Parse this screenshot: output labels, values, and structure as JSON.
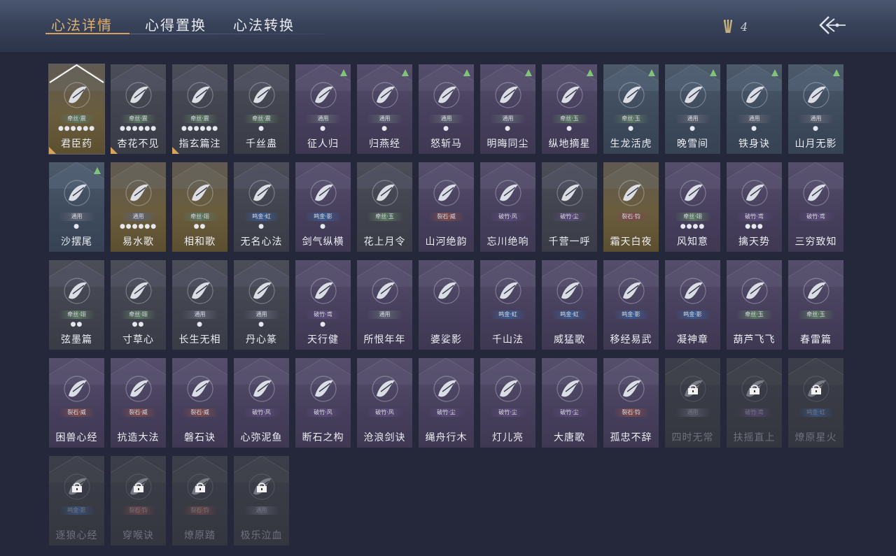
{
  "tabs": [
    "心法详情",
    "心得置换",
    "心法转换"
  ],
  "currency": {
    "icon": "arrow-bundle-icon",
    "value": "4"
  },
  "colors": {
    "accent": "#d6a062",
    "upgrade": "#7fc47a",
    "background": "#24283a"
  },
  "cards": [
    {
      "name": "君臣药",
      "tag": "牵丝·震",
      "tone": "gold",
      "tagcolor": "green",
      "dots": "●●●●●●",
      "corner": true,
      "up": false,
      "selected": true,
      "locked": false
    },
    {
      "name": "杏花不见",
      "tag": "牵丝·震",
      "tone": "gray",
      "tagcolor": "green",
      "dots": "●●●●●●",
      "corner": true,
      "up": false,
      "locked": false
    },
    {
      "name": "指玄篇注",
      "tag": "牵丝·震",
      "tone": "gray",
      "tagcolor": "green",
      "dots": "●●●●●●",
      "corner": true,
      "up": false,
      "locked": false
    },
    {
      "name": "千丝蛊",
      "tag": "牵丝·震",
      "tone": "gray",
      "tagcolor": "green",
      "dots": "●",
      "corner": false,
      "up": false,
      "locked": false
    },
    {
      "name": "征人归",
      "tag": "通用",
      "tone": "purple",
      "tagcolor": "gray",
      "dots": "●",
      "corner": false,
      "up": true,
      "locked": false
    },
    {
      "name": "归燕经",
      "tag": "通用",
      "tone": "purple",
      "tagcolor": "gray",
      "dots": "●",
      "corner": false,
      "up": true,
      "locked": false
    },
    {
      "name": "怒斩马",
      "tag": "通用",
      "tone": "purple",
      "tagcolor": "gray",
      "dots": "●",
      "corner": false,
      "up": true,
      "locked": false
    },
    {
      "name": "明晦同尘",
      "tag": "通用",
      "tone": "purple",
      "tagcolor": "gray",
      "dots": "●",
      "corner": false,
      "up": true,
      "locked": false
    },
    {
      "name": "纵地摘星",
      "tag": "牵丝·玉",
      "tone": "purple",
      "tagcolor": "green",
      "dots": "●",
      "corner": false,
      "up": true,
      "locked": false
    },
    {
      "name": "生龙活虎",
      "tag": "牵丝·玉",
      "tone": "teal",
      "tagcolor": "green",
      "dots": "●",
      "corner": false,
      "up": true,
      "locked": false
    },
    {
      "name": "晚雪间",
      "tag": "通用",
      "tone": "teal",
      "tagcolor": "gray",
      "dots": "●",
      "corner": false,
      "up": true,
      "locked": false
    },
    {
      "name": "铁身诀",
      "tag": "通用",
      "tone": "teal",
      "tagcolor": "gray",
      "dots": "●",
      "corner": false,
      "up": true,
      "locked": false
    },
    {
      "name": "山月无影",
      "tag": "通用",
      "tone": "teal",
      "tagcolor": "gray",
      "dots": "●",
      "corner": false,
      "up": true,
      "locked": false
    },
    {
      "name": "沙摆尾",
      "tag": "通用",
      "tone": "teal",
      "tagcolor": "gray",
      "dots": "●",
      "corner": false,
      "up": true,
      "locked": false
    },
    {
      "name": "易水歌",
      "tag": "通用",
      "tone": "gold",
      "tagcolor": "gray",
      "dots": "●●●●●●",
      "corner": false,
      "up": false,
      "locked": false
    },
    {
      "name": "相和歌",
      "tag": "牵丝·翊",
      "tone": "gold",
      "tagcolor": "green",
      "dots": "●●",
      "corner": false,
      "up": false,
      "locked": false
    },
    {
      "name": "无名心法",
      "tag": "鸣金·虹",
      "tone": "gray",
      "tagcolor": "blue",
      "dots": "●",
      "corner": false,
      "up": false,
      "locked": false
    },
    {
      "name": "剑气纵横",
      "tag": "鸣金·影",
      "tone": "purple",
      "tagcolor": "blue",
      "dots": "●",
      "corner": false,
      "up": false,
      "locked": false
    },
    {
      "name": "花上月令",
      "tag": "牵丝·玉",
      "tone": "gray",
      "tagcolor": "green",
      "dots": "",
      "corner": false,
      "up": false,
      "locked": false
    },
    {
      "name": "山河绝韵",
      "tag": "裂石·威",
      "tone": "purple",
      "tagcolor": "red",
      "dots": "",
      "corner": false,
      "up": false,
      "locked": false
    },
    {
      "name": "忘川绝响",
      "tag": "破竹·风",
      "tone": "purple",
      "tagcolor": "purple",
      "dots": "",
      "corner": false,
      "up": false,
      "locked": false
    },
    {
      "name": "千营一呼",
      "tag": "破竹·尘",
      "tone": "gray",
      "tagcolor": "purple",
      "dots": "",
      "corner": false,
      "up": false,
      "locked": false
    },
    {
      "name": "霜天白夜",
      "tag": "裂石·钧",
      "tone": "gold",
      "tagcolor": "red",
      "dots": "",
      "corner": false,
      "up": false,
      "locked": false
    },
    {
      "name": "风知意",
      "tag": "牵丝·翊",
      "tone": "purple",
      "tagcolor": "green",
      "dots": "●●●●",
      "corner": false,
      "up": false,
      "locked": false
    },
    {
      "name": "擒天势",
      "tag": "破竹·鸢",
      "tone": "purple",
      "tagcolor": "purple",
      "dots": "●●●",
      "corner": false,
      "up": false,
      "locked": false
    },
    {
      "name": "三穷致知",
      "tag": "破竹·鸢",
      "tone": "purple",
      "tagcolor": "purple",
      "dots": "",
      "corner": false,
      "up": false,
      "locked": false
    },
    {
      "name": "弦墨篇",
      "tag": "牵丝·翊",
      "tone": "gray",
      "tagcolor": "green",
      "dots": "●●",
      "corner": false,
      "up": false,
      "locked": false
    },
    {
      "name": "寸草心",
      "tag": "牵丝·翊",
      "tone": "gray",
      "tagcolor": "green",
      "dots": "●●",
      "corner": false,
      "up": false,
      "locked": false
    },
    {
      "name": "长生无相",
      "tag": "通用",
      "tone": "gray",
      "tagcolor": "gray",
      "dots": "●",
      "corner": false,
      "up": false,
      "locked": false
    },
    {
      "name": "丹心篆",
      "tag": "通用",
      "tone": "gray",
      "tagcolor": "gray",
      "dots": "●",
      "corner": false,
      "up": false,
      "locked": false
    },
    {
      "name": "天行健",
      "tag": "破竹·鸢",
      "tone": "purple",
      "tagcolor": "purple",
      "dots": "●",
      "corner": false,
      "up": false,
      "locked": false
    },
    {
      "name": "所恨年年",
      "tag": "通用",
      "tone": "purple",
      "tagcolor": "gray",
      "dots": "",
      "corner": false,
      "up": false,
      "locked": false
    },
    {
      "name": "婆娑影",
      "tag": "",
      "tone": "purple",
      "tagcolor": "gray",
      "dots": "",
      "corner": false,
      "up": false,
      "locked": false
    },
    {
      "name": "千山法",
      "tag": "鸣金·虹",
      "tone": "purple",
      "tagcolor": "blue",
      "dots": "",
      "corner": false,
      "up": false,
      "locked": false
    },
    {
      "name": "威猛歌",
      "tag": "鸣金·虹",
      "tone": "purple",
      "tagcolor": "blue",
      "dots": "",
      "corner": false,
      "up": false,
      "locked": false
    },
    {
      "name": "移经易武",
      "tag": "鸣金·影",
      "tone": "purple",
      "tagcolor": "blue",
      "dots": "",
      "corner": false,
      "up": false,
      "locked": false
    },
    {
      "name": "凝神章",
      "tag": "鸣金·影",
      "tone": "purple",
      "tagcolor": "blue",
      "dots": "",
      "corner": false,
      "up": false,
      "locked": false
    },
    {
      "name": "葫芦飞飞",
      "tag": "牵丝·玉",
      "tone": "purple",
      "tagcolor": "green",
      "dots": "",
      "corner": false,
      "up": false,
      "locked": false
    },
    {
      "name": "春雷篇",
      "tag": "牵丝·玉",
      "tone": "purple",
      "tagcolor": "green",
      "dots": "",
      "corner": false,
      "up": false,
      "locked": false
    },
    {
      "name": "困兽心经",
      "tag": "裂石·威",
      "tone": "purple",
      "tagcolor": "red",
      "dots": "",
      "corner": false,
      "up": false,
      "locked": false
    },
    {
      "name": "抗造大法",
      "tag": "裂石·威",
      "tone": "purple",
      "tagcolor": "red",
      "dots": "",
      "corner": false,
      "up": false,
      "locked": false
    },
    {
      "name": "磐石诀",
      "tag": "裂石·威",
      "tone": "purple",
      "tagcolor": "red",
      "dots": "",
      "corner": false,
      "up": false,
      "locked": false
    },
    {
      "name": "心弥泥鱼",
      "tag": "破竹·风",
      "tone": "purple",
      "tagcolor": "purple",
      "dots": "",
      "corner": false,
      "up": false,
      "locked": false
    },
    {
      "name": "断石之构",
      "tag": "破竹·风",
      "tone": "purple",
      "tagcolor": "purple",
      "dots": "",
      "corner": false,
      "up": false,
      "locked": false
    },
    {
      "name": "沧浪剑诀",
      "tag": "破竹·风",
      "tone": "purple",
      "tagcolor": "purple",
      "dots": "",
      "corner": false,
      "up": false,
      "locked": false
    },
    {
      "name": "绳舟行木",
      "tag": "破竹·尘",
      "tone": "purple",
      "tagcolor": "purple",
      "dots": "",
      "corner": false,
      "up": false,
      "locked": false
    },
    {
      "name": "灯儿亮",
      "tag": "破竹·尘",
      "tone": "purple",
      "tagcolor": "purple",
      "dots": "",
      "corner": false,
      "up": false,
      "locked": false
    },
    {
      "name": "大唐歌",
      "tag": "破竹·尘",
      "tone": "purple",
      "tagcolor": "purple",
      "dots": "",
      "corner": false,
      "up": false,
      "locked": false
    },
    {
      "name": "孤忠不辞",
      "tag": "裂石·钧",
      "tone": "purple",
      "tagcolor": "red",
      "dots": "",
      "corner": false,
      "up": false,
      "locked": false
    },
    {
      "name": "四时无常",
      "tag": "通用",
      "tone": "locked",
      "tagcolor": "gray",
      "dots": "",
      "corner": false,
      "up": false,
      "locked": true
    },
    {
      "name": "扶摇直上",
      "tag": "破竹·鸢",
      "tone": "locked",
      "tagcolor": "purple",
      "dots": "",
      "corner": false,
      "up": false,
      "locked": true
    },
    {
      "name": "燎原星火",
      "tag": "鸣金·虹",
      "tone": "locked",
      "tagcolor": "blue",
      "dots": "",
      "corner": false,
      "up": false,
      "locked": true
    },
    {
      "name": "逐狼心经",
      "tag": "鸣金·影",
      "tone": "locked",
      "tagcolor": "blue",
      "dots": "",
      "corner": false,
      "up": false,
      "locked": true
    },
    {
      "name": "穿喉诀",
      "tag": "裂石·钧",
      "tone": "locked",
      "tagcolor": "red",
      "dots": "",
      "corner": false,
      "up": false,
      "locked": true
    },
    {
      "name": "燎原踏",
      "tag": "裂石·钧",
      "tone": "locked",
      "tagcolor": "red",
      "dots": "",
      "corner": false,
      "up": false,
      "locked": true
    },
    {
      "name": "极乐泣血",
      "tag": "通用",
      "tone": "locked",
      "tagcolor": "gray",
      "dots": "",
      "corner": false,
      "up": false,
      "locked": true
    }
  ]
}
